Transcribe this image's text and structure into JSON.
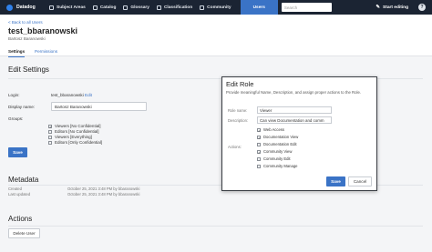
{
  "nav": {
    "brand": "Datadog",
    "items": [
      {
        "label": "Subject Areas",
        "icon": "subject-areas-icon"
      },
      {
        "label": "Catalog",
        "icon": "catalog-icon"
      },
      {
        "label": "Glossary",
        "icon": "glossary-icon"
      },
      {
        "label": "Classification",
        "icon": "classification-icon"
      },
      {
        "label": "Community",
        "icon": "community-icon"
      }
    ],
    "active": "Users",
    "search_placeholder": "Search",
    "start_editing": "Start editing",
    "help": "?"
  },
  "header": {
    "back": "< Back to all Users",
    "title": "test_bbaranowski",
    "subtitle": "Bartosz Baranowski",
    "tabs": [
      "Settings",
      "Permissions"
    ]
  },
  "settings": {
    "heading": "Edit Settings",
    "login_label": "Login:",
    "login_value": "test_bbaranowski",
    "login_edit": "Edit",
    "display_label": "Display name:",
    "display_value": "Bartosz Baranowski",
    "groups_label": "Groups:",
    "groups": [
      {
        "label": "Viewers [No Confidential]",
        "checked": true
      },
      {
        "label": "Editors [No Confidential]",
        "checked": false
      },
      {
        "label": "Viewers [Everything]",
        "checked": false
      },
      {
        "label": "Editors [Only Confidential]",
        "checked": false
      }
    ],
    "save": "Save"
  },
  "metadata": {
    "heading": "Metadata",
    "created_label": "Created",
    "created_value": "October 25, 2021 3:48 PM by bbaranowski",
    "updated_label": "Last updated",
    "updated_value": "October 25, 2021 3:48 PM by bbaranowski"
  },
  "actions": {
    "heading": "Actions",
    "delete": "Delete User"
  },
  "modal": {
    "title": "Edit Role",
    "description": "Provide meaningful Name, Description, and assign proper actions to the Role.",
    "role_name_label": "Role name:",
    "role_name_value": "Viewer",
    "description_label": "Description:",
    "description_value": "Can view Documentation and comm",
    "actions_label": "Actions:",
    "actions": [
      {
        "label": "Web Access",
        "checked": true
      },
      {
        "label": "Documentation View",
        "checked": true
      },
      {
        "label": "Documentation Edit",
        "checked": false
      },
      {
        "label": "Community View",
        "checked": true
      },
      {
        "label": "Community Edit",
        "checked": false
      },
      {
        "label": "Community Manage",
        "checked": false
      }
    ],
    "save": "Save",
    "cancel": "Cancel"
  },
  "colors": {
    "nav_bg": "#1b2433",
    "accent": "#3a73c6"
  }
}
